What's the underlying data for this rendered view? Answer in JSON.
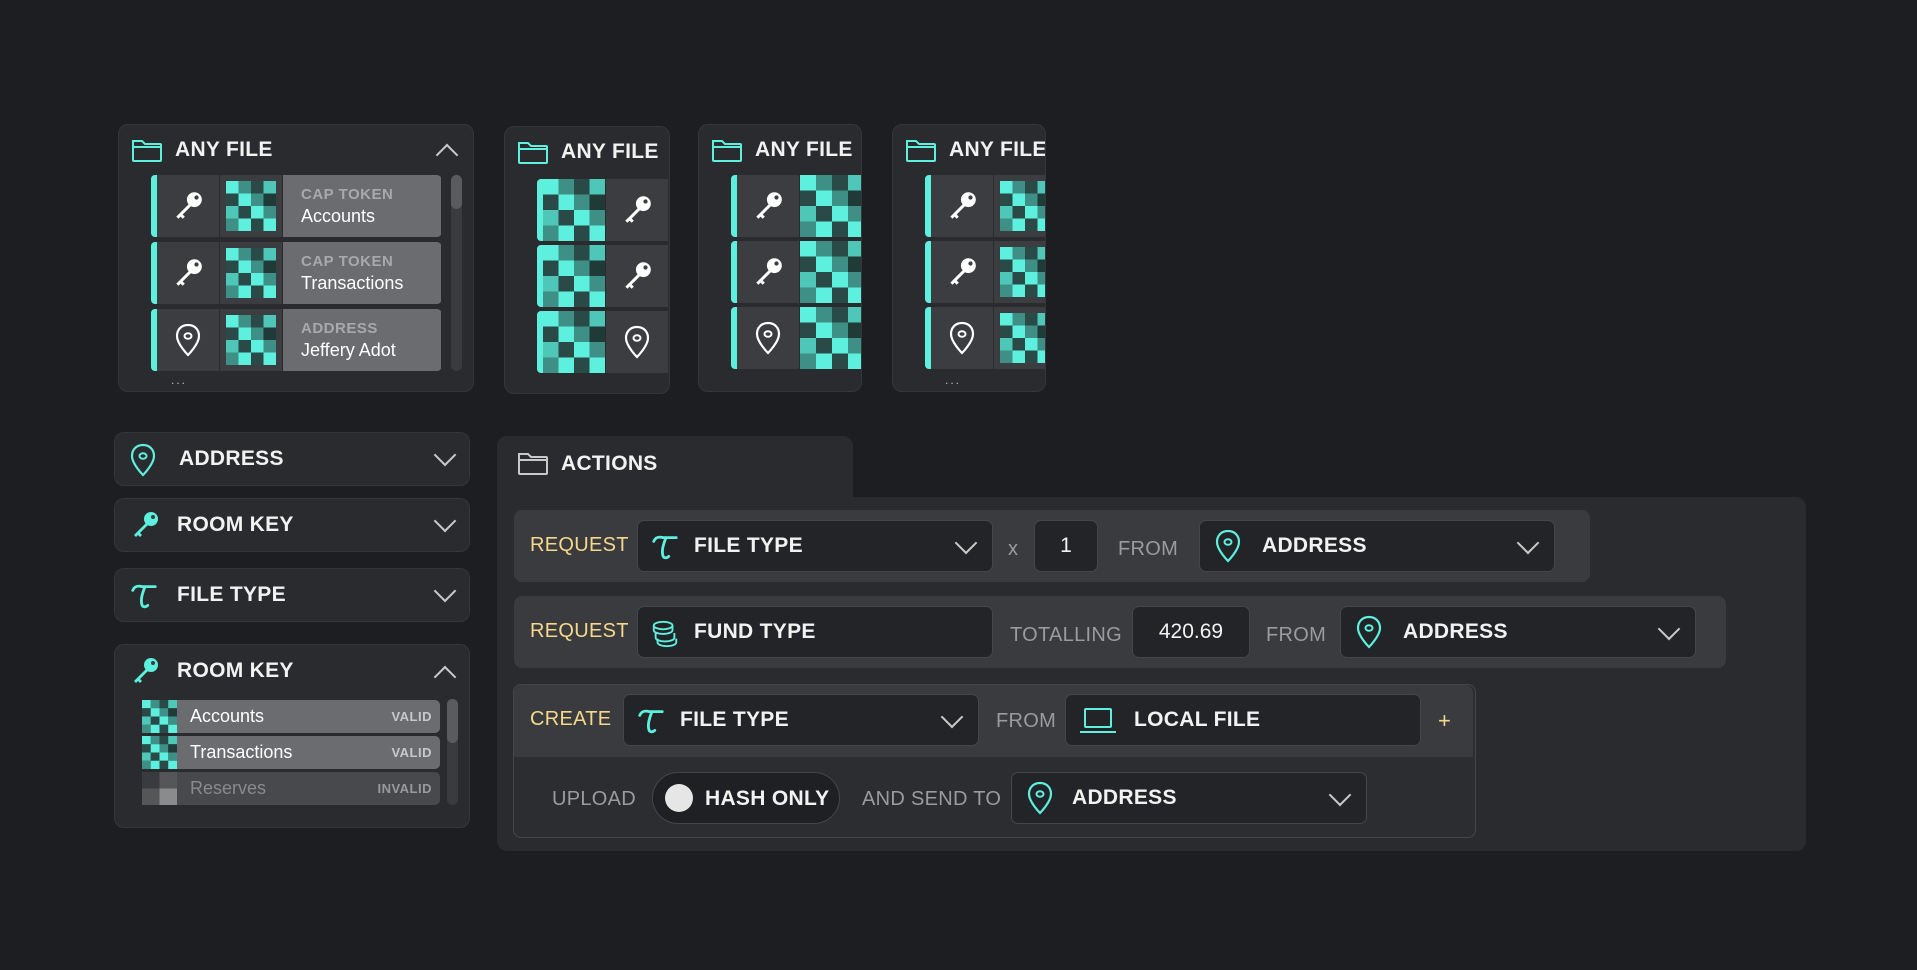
{
  "colors": {
    "accent": "#5ef0de",
    "keyword": "#f5d88b",
    "panel": "#2a2b2e",
    "background": "#1c1e22"
  },
  "file_pickers": [
    {
      "title": "ANY FILE",
      "items": [
        {
          "icon": "key-icon",
          "sub": "CAP TOKEN",
          "label": "Accounts"
        },
        {
          "icon": "key-icon",
          "sub": "CAP TOKEN",
          "label": "Transactions"
        },
        {
          "icon": "map-pin-icon",
          "sub": "ADDRESS",
          "label": "Jeffery Adot"
        }
      ],
      "more": "..."
    },
    {
      "title": "ANY FILE"
    },
    {
      "title": "ANY FILE"
    },
    {
      "title": "ANY FILE",
      "more": "..."
    }
  ],
  "accordions": [
    {
      "label": "ADDRESS",
      "icon": "map-pin-icon",
      "state": "collapsed"
    },
    {
      "label": "ROOM KEY",
      "icon": "key-icon",
      "state": "collapsed"
    },
    {
      "label": "FILE TYPE",
      "icon": "tau-icon",
      "state": "collapsed"
    }
  ],
  "room_key_panel": {
    "label": "ROOM KEY",
    "state": "expanded",
    "items": [
      {
        "name": "Accounts",
        "status": "VALID"
      },
      {
        "name": "Transactions",
        "status": "VALID"
      },
      {
        "name": "Reserves",
        "status": "INVALID"
      }
    ]
  },
  "actions": {
    "title": "ACTIONS",
    "row1": {
      "verb": "REQUEST",
      "type": "FILE TYPE",
      "times": "x",
      "qty": "1",
      "from": "FROM",
      "source": "ADDRESS"
    },
    "row2": {
      "verb": "REQUEST",
      "type": "FUND TYPE",
      "totalling": "TOTALLING",
      "amount": "420.69",
      "from": "FROM",
      "source": "ADDRESS"
    },
    "row3": {
      "verb": "CREATE",
      "type": "FILE TYPE",
      "from": "FROM",
      "source": "LOCAL FILE",
      "add": "+"
    },
    "row4": {
      "upload": "UPLOAD",
      "toggle": "HASH ONLY",
      "send": "AND SEND TO",
      "dest": "ADDRESS"
    }
  }
}
